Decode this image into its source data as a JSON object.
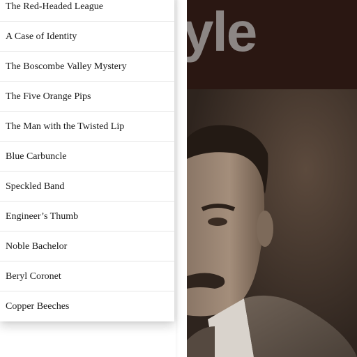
{
  "hero": {
    "banner_title_fragment": "yle",
    "portrait_alt": "portrait-photo"
  },
  "menu": {
    "items": [
      {
        "label": "The Red-Headed League"
      },
      {
        "label": "A Case of Identity"
      },
      {
        "label": "The Boscombe Valley Mystery"
      },
      {
        "label": "The Five Orange Pips"
      },
      {
        "label": "The Man with the Twisted Lip"
      },
      {
        "label": "Blue Carbuncle"
      },
      {
        "label": "Speckled Band"
      },
      {
        "label": "Engineer’s Thumb"
      },
      {
        "label": "Noble Bachelor"
      },
      {
        "label": "Beryl Coronet"
      },
      {
        "label": "Copper Beeches"
      }
    ]
  },
  "colors": {
    "banner_bg": "#2a1712",
    "banner_text": "#8c8684",
    "menu_bg": "#ffffff",
    "menu_text": "#1a1a1a",
    "divider": "#e6e6e6"
  }
}
